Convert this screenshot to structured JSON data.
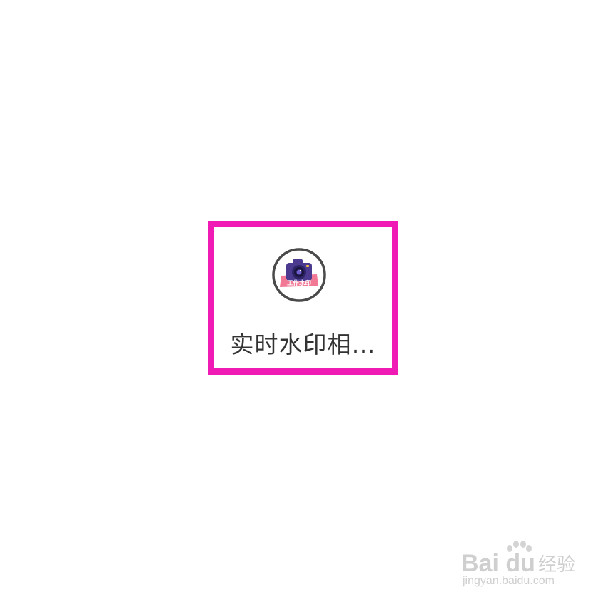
{
  "app": {
    "label": "实时水印相…",
    "icon_name": "watermark-camera-app-icon",
    "icon_badge": "工作水印"
  },
  "highlight": {
    "color": "#f01ab4"
  },
  "watermark": {
    "logo": "Bai du",
    "jingyan": "经验",
    "url": "jingyan.baidu.com"
  }
}
